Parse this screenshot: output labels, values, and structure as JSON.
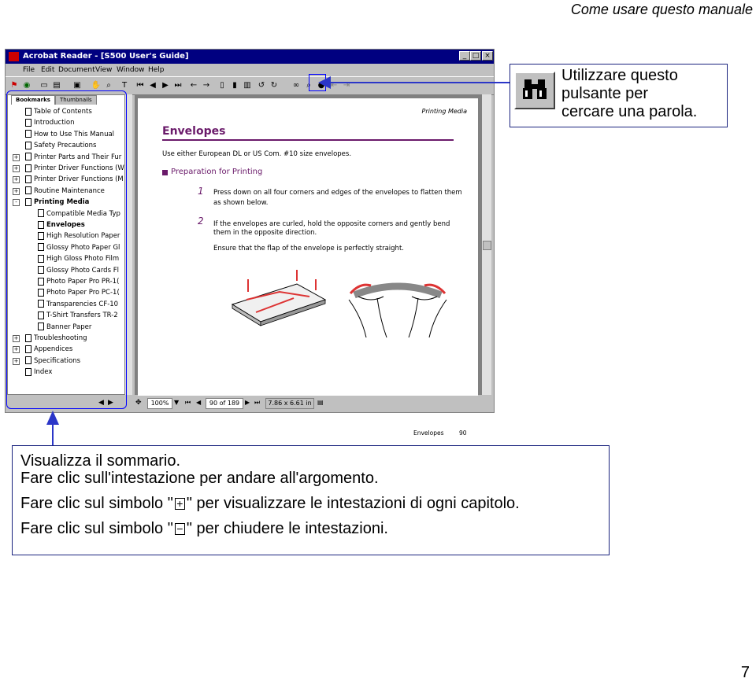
{
  "header": {
    "running_title": "Come usare questo manuale",
    "page_number": "7"
  },
  "window": {
    "title": "Acrobat Reader - [S500 User's Guide]",
    "controls": {
      "minimize": "_",
      "maximize": "□",
      "close": "×"
    },
    "menu": [
      "File",
      "Edit",
      "Document",
      "View",
      "Window",
      "Help"
    ],
    "tabs": {
      "bookmarks": "Bookmarks",
      "thumbnails": "Thumbnails"
    },
    "bookmarks": [
      {
        "label": "Table of Contents",
        "level": 0,
        "expander": ""
      },
      {
        "label": "Introduction",
        "level": 0,
        "expander": ""
      },
      {
        "label": "How to Use This Manual",
        "level": 0,
        "expander": ""
      },
      {
        "label": "Safety Precautions",
        "level": 0,
        "expander": ""
      },
      {
        "label": "Printer Parts and Their Fur",
        "level": 0,
        "expander": "+"
      },
      {
        "label": "Printer Driver Functions (W",
        "level": 0,
        "expander": "+"
      },
      {
        "label": "Printer Driver Functions (M",
        "level": 0,
        "expander": "+"
      },
      {
        "label": "Routine Maintenance",
        "level": 0,
        "expander": "+"
      },
      {
        "label": "Printing Media",
        "level": 0,
        "expander": "-"
      },
      {
        "label": "Compatible Media Typ",
        "level": 1,
        "expander": ""
      },
      {
        "label": "Envelopes",
        "level": 1,
        "expander": ""
      },
      {
        "label": "High Resolution Paper",
        "level": 1,
        "expander": ""
      },
      {
        "label": "Glossy Photo Paper Gl",
        "level": 1,
        "expander": ""
      },
      {
        "label": "High Gloss Photo Film",
        "level": 1,
        "expander": ""
      },
      {
        "label": "Glossy Photo Cards Fl",
        "level": 1,
        "expander": ""
      },
      {
        "label": "Photo Paper Pro PR-1(",
        "level": 1,
        "expander": ""
      },
      {
        "label": "Photo Paper Pro PC-1(",
        "level": 1,
        "expander": ""
      },
      {
        "label": "Transparencies CF-10",
        "level": 1,
        "expander": ""
      },
      {
        "label": "T-Shirt Transfers TR-2",
        "level": 1,
        "expander": ""
      },
      {
        "label": "Banner Paper",
        "level": 1,
        "expander": ""
      },
      {
        "label": "Troubleshooting",
        "level": 0,
        "expander": "+"
      },
      {
        "label": "Appendices",
        "level": 0,
        "expander": "+"
      },
      {
        "label": "Specifications",
        "level": 0,
        "expander": "+"
      },
      {
        "label": "Index",
        "level": 0,
        "expander": ""
      }
    ],
    "status": {
      "zoom": "100%",
      "page": "90 of 189",
      "size": "7.86 x 6.61 in"
    }
  },
  "document": {
    "running_head": "Printing Media",
    "title": "Envelopes",
    "intro": "Use either European DL or US Com. #10 size envelopes.",
    "subhead": "Preparation for Printing",
    "steps": [
      {
        "num": "1",
        "text_1": "Press down on all four corners and edges of the envelopes to flatten them",
        "text_2": "as shown below."
      },
      {
        "num": "2",
        "text_1": "If the envelopes are curled, hold the opposite corners and gently bend",
        "text_2": "them in the opposite direction."
      }
    ],
    "note": "Ensure that the flap of the envelope is perfectly straight.",
    "footer_label": "Envelopes",
    "footer_page": "90"
  },
  "callout_search": {
    "text_1": "Utilizzare questo",
    "text_2": "pulsante per",
    "text_3": "cercare una parola."
  },
  "callout_bookmarks": {
    "line_1": "Visualizza il sommario.",
    "line_2": "Fare clic sull'intestazione per andare all'argomento.",
    "line_3a": "Fare clic sul simbolo \"",
    "plus_symbol": "+",
    "line_3b": "\" per visualizzare le intestazioni di ogni capitolo.",
    "line_4a": "Fare clic sul simbolo \"",
    "minus_symbol": "−",
    "line_4b": "\" per chiudere le intestazioni."
  },
  "colors": {
    "callout_border": "#1a237e",
    "highlight": "#0000ff",
    "connector": "#2b36c8",
    "doc_accent": "#6a1a6a"
  }
}
